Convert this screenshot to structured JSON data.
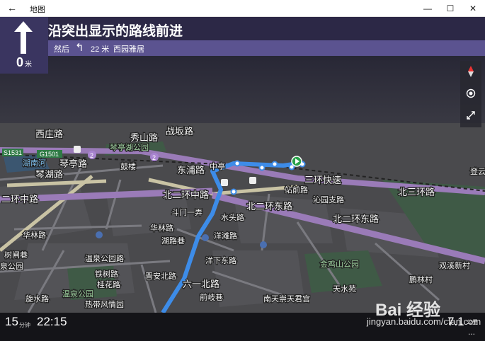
{
  "window": {
    "title": "地图",
    "back": "←",
    "minimize": "—",
    "maximize": "☐",
    "close": "✕"
  },
  "navigation": {
    "instruction": "沿突出显示的路线前进",
    "turn_distance": "0",
    "turn_distance_unit": "米",
    "next_prefix": "然后",
    "next_arrow": "↰",
    "next_distance": "22 米",
    "next_place": "西园雅居"
  },
  "tools": {
    "compass_icon": "compass-icon",
    "locate_icon": "locate-icon",
    "expand_icon": "expand-icon"
  },
  "status": {
    "minutes": "15",
    "minutes_unit": "分钟",
    "arrival_time": "22:15",
    "remaining_distance": "7.1",
    "remaining_unit_line1": "公里",
    "more": "..."
  },
  "map_labels": {
    "road_1": "秀山路",
    "road_2": "战坂路",
    "road_3": "西庄路",
    "road_4": "G1501",
    "road_5": "S1531",
    "road_6": "琴亭湖公园",
    "road_7": "湖南河",
    "road_8": "琴亭路",
    "road_9": "琴湖路",
    "road_10": "东浦路",
    "road_11": "三环快速",
    "road_12": "北三环路",
    "road_13": "二环中路",
    "road_14": "北二环中路",
    "road_15": "北二环东路",
    "road_16": "站前路",
    "road_17": "沁园支路",
    "road_18": "斗门一弄",
    "road_19": "水头路",
    "road_20": "华林路",
    "road_21": "湖路巷",
    "road_22": "洋滩路",
    "road_23": "温泉公园路",
    "road_24": "铁树路",
    "road_25": "桂花路",
    "road_26": "温泉公园",
    "road_27": "洋下东路",
    "road_28": "金鸡山公园",
    "road_29": "双溪新村",
    "road_30": "登云",
    "road_31": "前岐巷",
    "road_32": "南天崇天君宫",
    "road_33": "六一北路",
    "road_34": "树闸巷",
    "road_35": "泉公园",
    "road_36": "旋水路",
    "road_37": "热带风情园",
    "road_38": "晋安北路",
    "road_39": "中亭",
    "road_40": "北二环东路",
    "road_41": "鹏林村",
    "road_42": "天水苑",
    "road_43": "华林路",
    "road_44": "鼓楼",
    "badge_1": "2",
    "badge_2": "2"
  },
  "watermark": {
    "logo": "Bai 经验",
    "url": "jingyan.baidu.com/cfan.com"
  }
}
